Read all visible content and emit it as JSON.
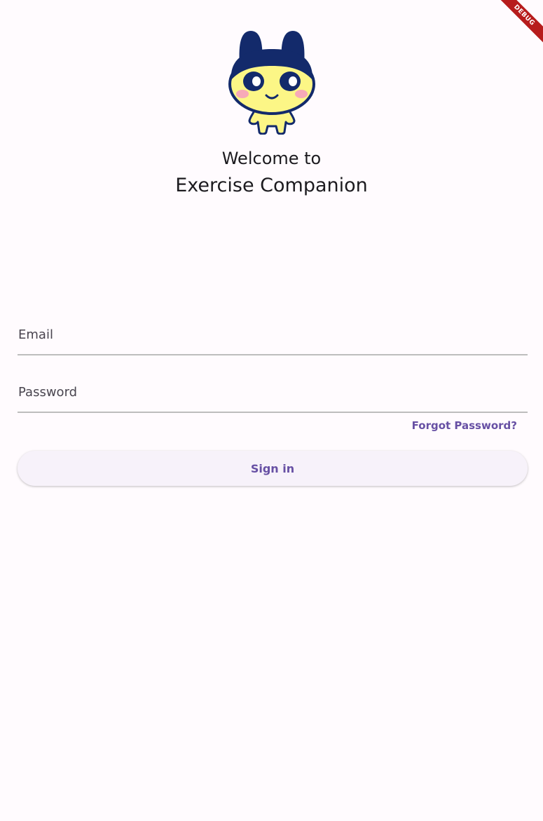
{
  "debug_banner": {
    "label": "DEBUG",
    "color": "#b71c1c"
  },
  "header": {
    "mascot_icon": "cartoon-mascot-icon",
    "welcome_line1": "Welcome to",
    "welcome_line2": "Exercise Companion"
  },
  "form": {
    "email_placeholder": "Email",
    "email_value": "",
    "password_placeholder": "Password",
    "password_value": "",
    "forgot_password_label": "Forgot Password?",
    "signin_label": "Sign in"
  },
  "colors": {
    "accent": "#6750a4",
    "background": "#fffbfe",
    "button_bg": "#f7f2fa",
    "mascot_navy": "#132a6b",
    "mascot_yellow": "#fcf686",
    "mascot_cheek": "#f7a9b8"
  }
}
